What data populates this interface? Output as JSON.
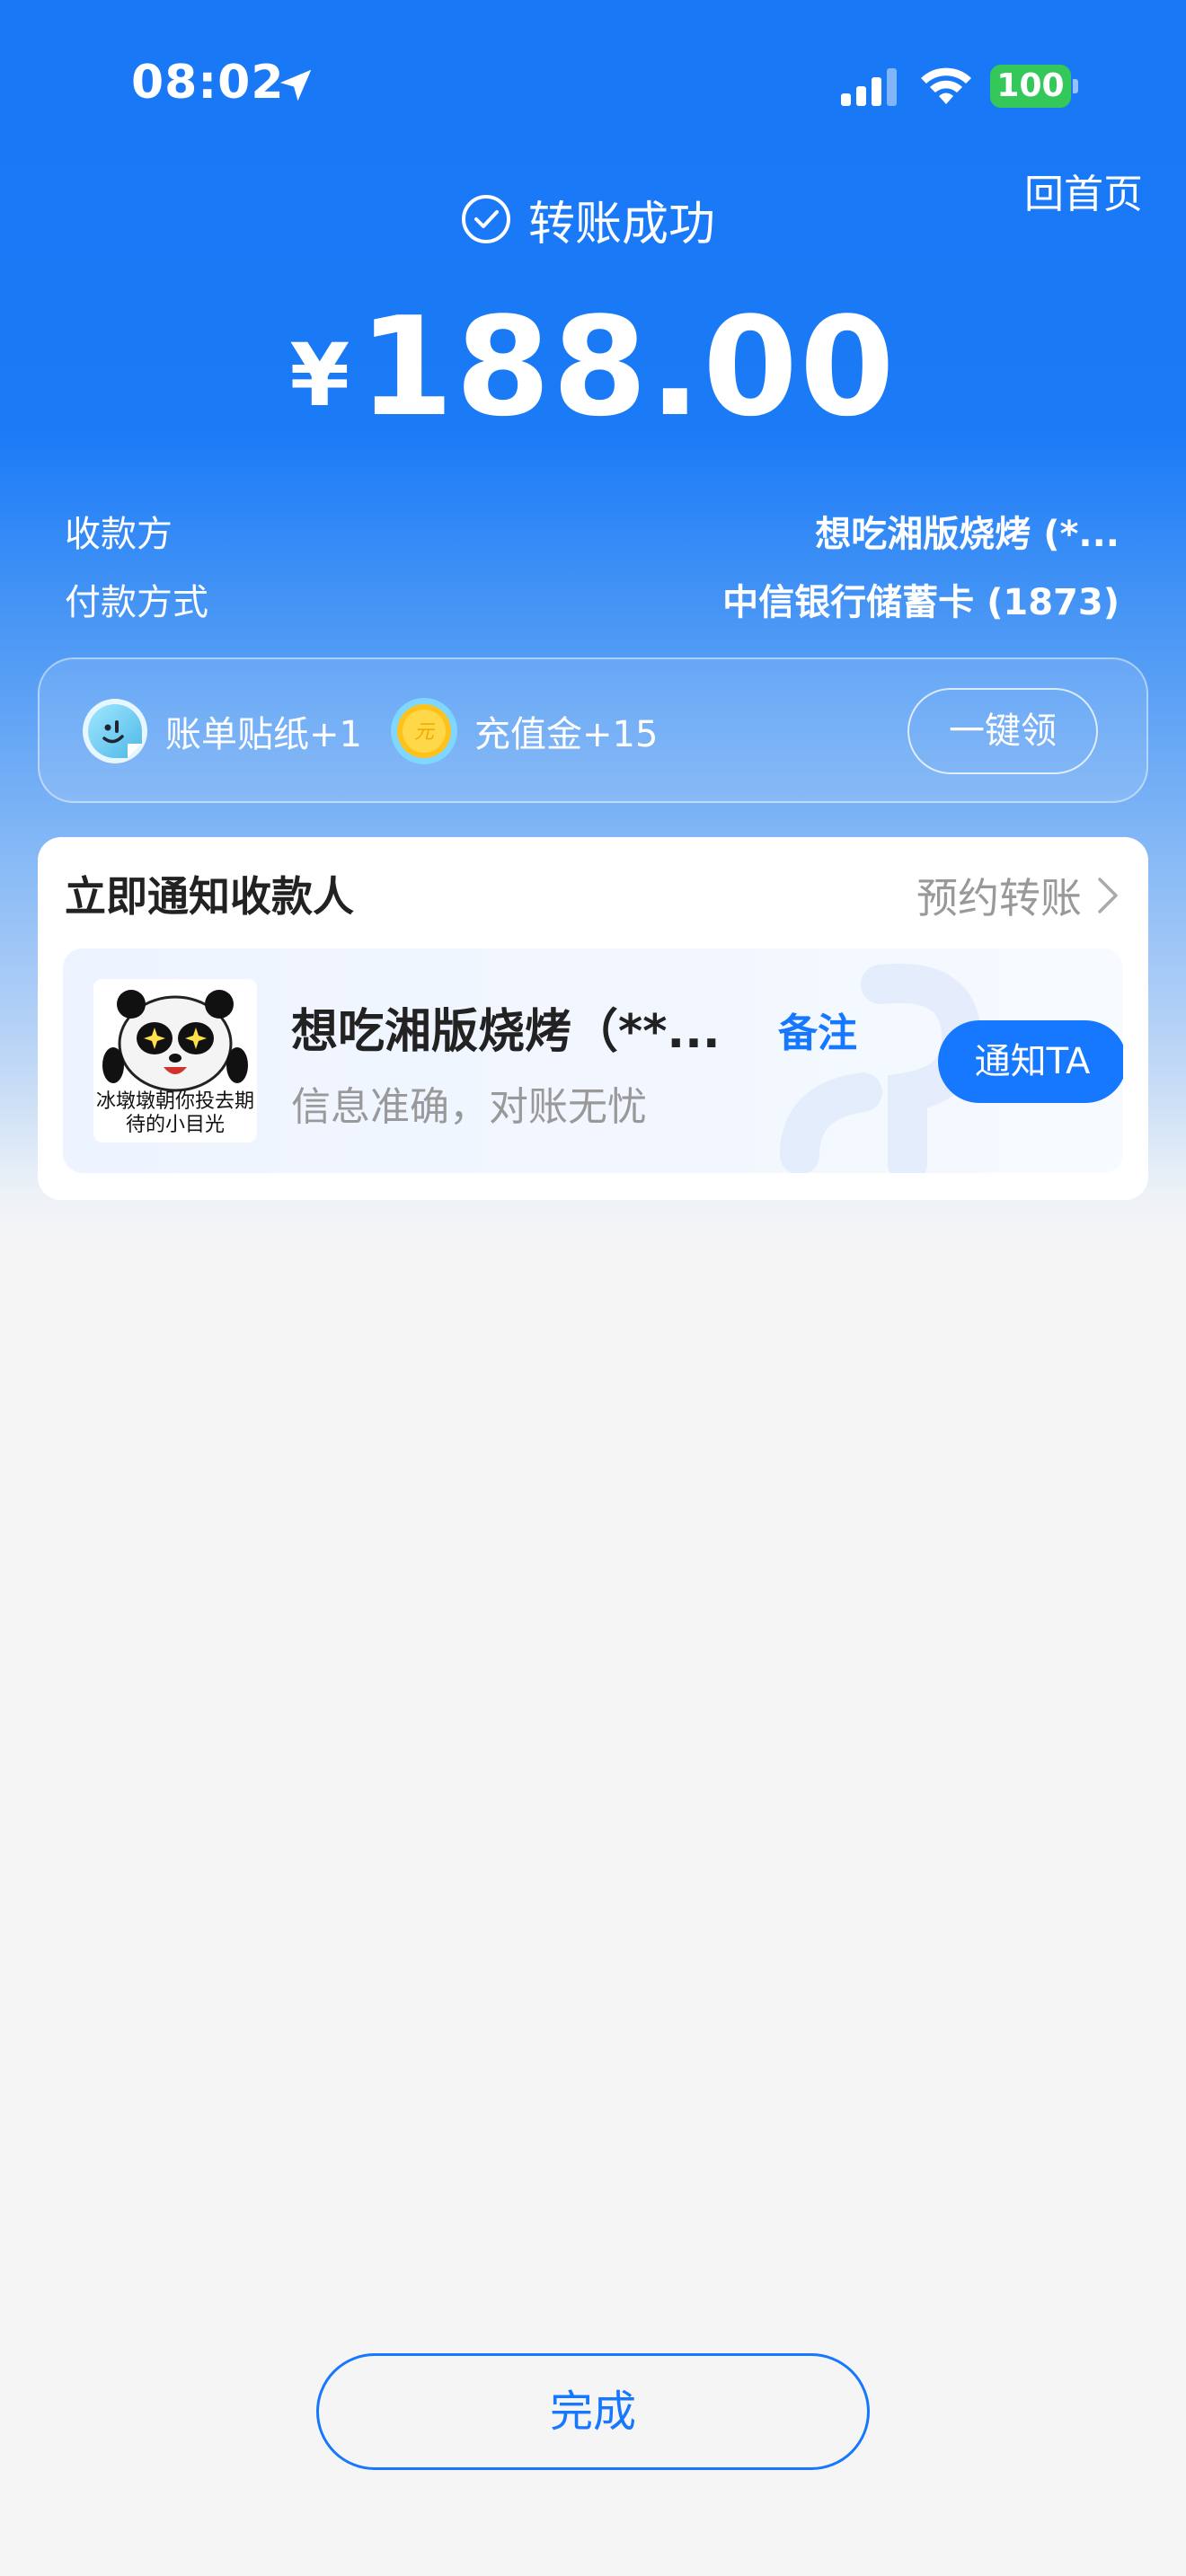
{
  "status_bar": {
    "time": "08:02",
    "battery": "100"
  },
  "header": {
    "home_link": "回首页",
    "success_text": "转账成功",
    "currency": "¥",
    "amount": "188.00"
  },
  "details": [
    {
      "label": "收款方",
      "value": "想吃湘版烧烤 (*..."
    },
    {
      "label": "付款方式",
      "value": "中信银行储蓄卡 (1873)"
    }
  ],
  "rewards": {
    "items": [
      {
        "label": "账单贴纸+1",
        "icon": "sticker-icon"
      },
      {
        "label": "充值金+15",
        "icon": "coin-icon"
      }
    ],
    "claim_label": "一键领"
  },
  "notify": {
    "title": "立即通知收款人",
    "schedule_link": "预约转账",
    "sticker_caption": "冰墩墩朝你投去期待的小目光",
    "payee_name": "想吃湘版烧烤（**...",
    "remark_label": "备注",
    "subtitle": "信息准确，对账无忧",
    "notify_button": "通知TA"
  },
  "footer": {
    "done_label": "完成"
  },
  "colors": {
    "primary_blue": "#1677ff",
    "battery_green": "#34c759"
  }
}
